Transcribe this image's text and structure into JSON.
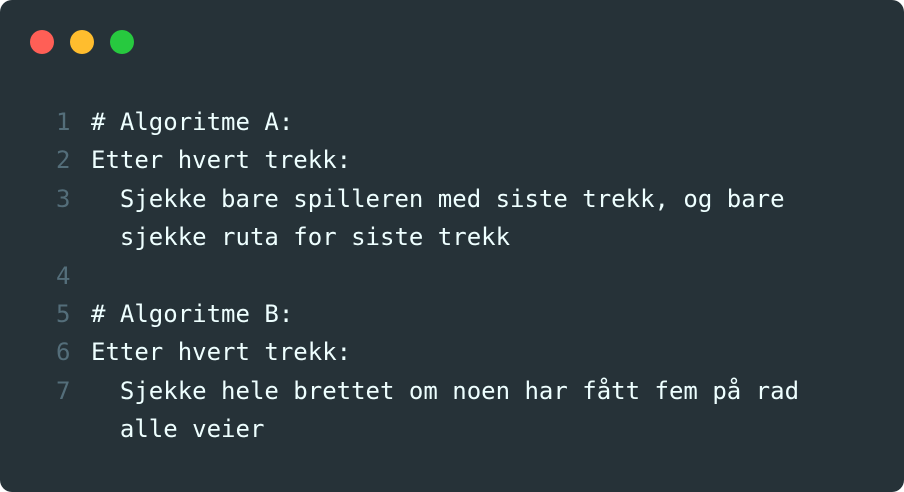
{
  "window": {
    "traffic_lights": {
      "close": "#ff5f56",
      "minimize": "#ffbd2e",
      "maximize": "#27c93f"
    },
    "background": "#263238"
  },
  "code": {
    "lines": [
      {
        "number": "1",
        "text": "# Algoritme A:"
      },
      {
        "number": "2",
        "text": "Etter hvert trekk:"
      },
      {
        "number": "3",
        "text": "  Sjekke bare spilleren med siste trekk, og bare",
        "cont": "  sjekke ruta for siste trekk"
      },
      {
        "number": "4",
        "text": ""
      },
      {
        "number": "5",
        "text": "# Algoritme B:"
      },
      {
        "number": "6",
        "text": "Etter hvert trekk:"
      },
      {
        "number": "7",
        "text": "  Sjekke hele brettet om noen har fått fem på rad",
        "cont": "  alle veier"
      }
    ]
  }
}
